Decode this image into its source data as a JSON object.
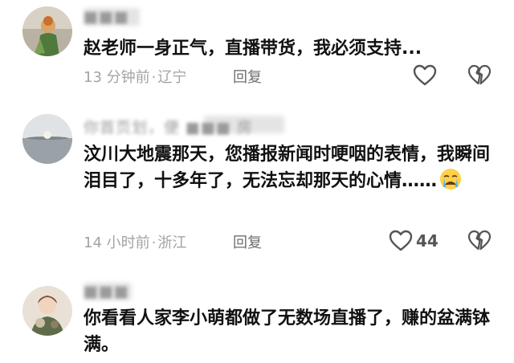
{
  "comments": [
    {
      "username": "■■■",
      "text": "赵老师一身正气，直播带货，我必须支持...",
      "time": "13 分钟前",
      "location": "辽宁",
      "reply_label": "回复",
      "like_icon": "heart-outline-icon",
      "dislike_icon": "broken-heart-icon"
    },
    {
      "username": "你首页划，便  ■■■  房",
      "text": "汶川大地震那天，您播报新闻时哽咽的表情，我瞬间泪目了，十多年了，无法忘却那天的心情……",
      "emoji": "crying-face-emoji",
      "time": "14 小时前",
      "location": "浙江",
      "reply_label": "回复",
      "like_count": "44",
      "like_icon": "heart-outline-icon",
      "dislike_icon": "broken-heart-icon"
    },
    {
      "username": "■■■",
      "text": "你看看人家李小萌都做了无数场直播了，赚的盆满钵满。"
    }
  ],
  "colors": {
    "text": "#111111",
    "meta": "#a3a3a3",
    "reply": "#6f6f6f",
    "icon": "#555555"
  }
}
